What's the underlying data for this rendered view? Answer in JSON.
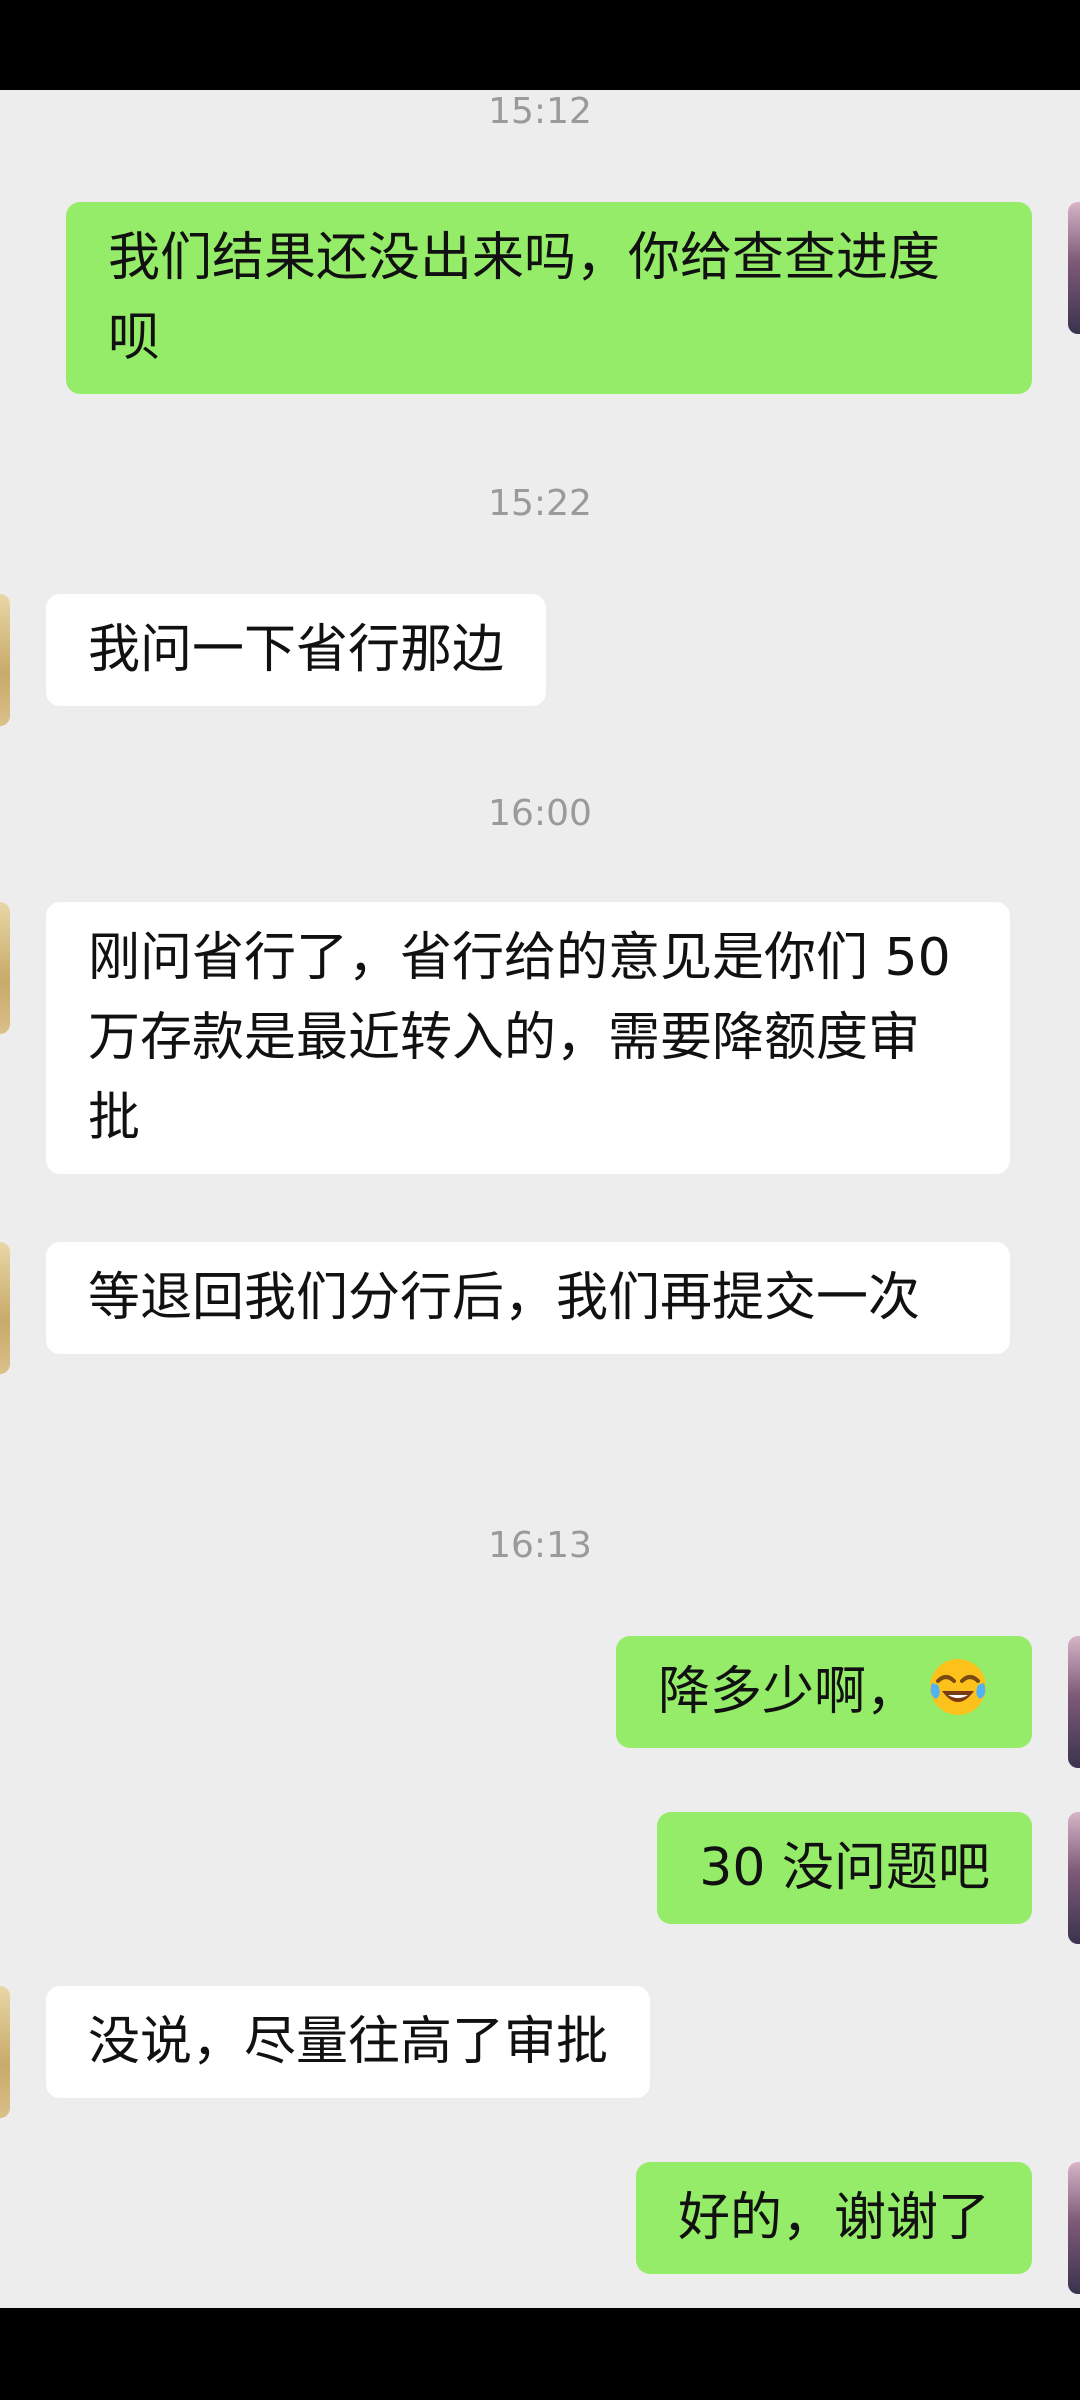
{
  "messages": [
    {
      "type": "time",
      "text": "15:12"
    },
    {
      "type": "out",
      "text": "我们结果还没出来吗，你给查查进度呗"
    },
    {
      "type": "time",
      "text": "15:22"
    },
    {
      "type": "in",
      "text": "我问一下省行那边"
    },
    {
      "type": "time",
      "text": "16:00"
    },
    {
      "type": "in",
      "text": "刚问省行了，省行给的意见是你们 50 万存款是最近转入的，需要降额度审批"
    },
    {
      "type": "in",
      "text": "等退回我们分行后，我们再提交一次"
    },
    {
      "type": "time",
      "text": "16:13"
    },
    {
      "type": "out",
      "text": "降多少啊，",
      "emoji": "tears-of-joy-emoji"
    },
    {
      "type": "out",
      "text": "30 没问题吧"
    },
    {
      "type": "in",
      "text": "没说，尽量往高了审批"
    },
    {
      "type": "out",
      "text": "好的，谢谢了"
    }
  ],
  "colors": {
    "background": "#ededed",
    "outgoing_bubble": "#95ec69",
    "incoming_bubble": "#ffffff",
    "timestamp": "#9a9a9a"
  }
}
